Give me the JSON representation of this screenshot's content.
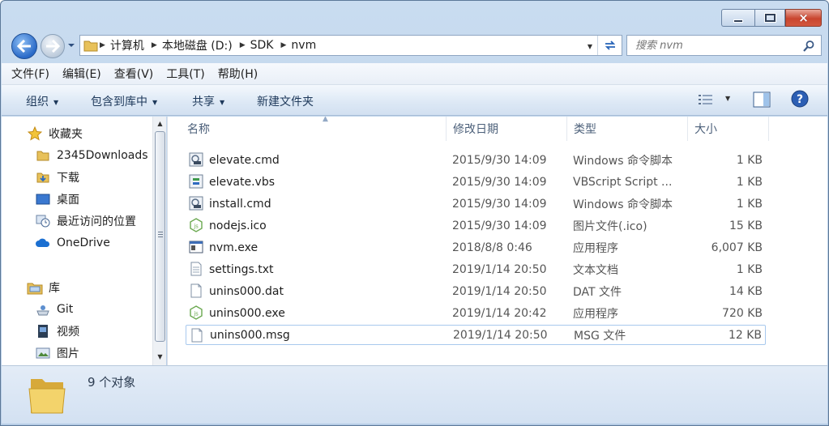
{
  "window": {
    "controls": {
      "minimize": "minimize",
      "maximize": "maximize",
      "close": "×"
    }
  },
  "address": {
    "crumbs": [
      "计算机",
      "本地磁盘 (D:)",
      "SDK",
      "nvm"
    ]
  },
  "search": {
    "placeholder": "搜索 nvm"
  },
  "menu": [
    "文件(F)",
    "编辑(E)",
    "查看(V)",
    "工具(T)",
    "帮助(H)"
  ],
  "commands": {
    "organize": "组织",
    "include_library": "包含到库中",
    "share": "共享",
    "new_folder": "新建文件夹"
  },
  "nav": {
    "favorites": "收藏夹",
    "fav_items": [
      "2345Downloads",
      "下载",
      "桌面",
      "最近访问的位置"
    ],
    "onedrive": "OneDrive",
    "libraries": "库",
    "lib_items": [
      "Git",
      "视频",
      "图片"
    ]
  },
  "columns": {
    "name": "名称",
    "modified": "修改日期",
    "type": "类型",
    "size": "大小"
  },
  "files": [
    {
      "name": "elevate.cmd",
      "modified": "2015/9/30 14:09",
      "type": "Windows 命令脚本",
      "size": "1 KB",
      "icon": "cmd-script-icon"
    },
    {
      "name": "elevate.vbs",
      "modified": "2015/9/30 14:09",
      "type": "VBScript Script ...",
      "size": "1 KB",
      "icon": "vbs-script-icon"
    },
    {
      "name": "install.cmd",
      "modified": "2015/9/30 14:09",
      "type": "Windows 命令脚本",
      "size": "1 KB",
      "icon": "cmd-script-icon"
    },
    {
      "name": "nodejs.ico",
      "modified": "2015/9/30 14:09",
      "type": "图片文件(.ico)",
      "size": "15 KB",
      "icon": "nodejs-icon"
    },
    {
      "name": "nvm.exe",
      "modified": "2018/8/8 0:46",
      "type": "应用程序",
      "size": "6,007 KB",
      "icon": "exe-icon"
    },
    {
      "name": "settings.txt",
      "modified": "2019/1/14 20:50",
      "type": "文本文档",
      "size": "1 KB",
      "icon": "text-file-icon"
    },
    {
      "name": "unins000.dat",
      "modified": "2019/1/14 20:50",
      "type": "DAT 文件",
      "size": "14 KB",
      "icon": "blank-file-icon"
    },
    {
      "name": "unins000.exe",
      "modified": "2019/1/14 20:42",
      "type": "应用程序",
      "size": "720 KB",
      "icon": "nodejs-icon"
    },
    {
      "name": "unins000.msg",
      "modified": "2019/1/14 20:50",
      "type": "MSG 文件",
      "size": "12 KB",
      "icon": "blank-file-icon"
    }
  ],
  "selected_index": 8,
  "status": {
    "count": "9 个对象"
  }
}
